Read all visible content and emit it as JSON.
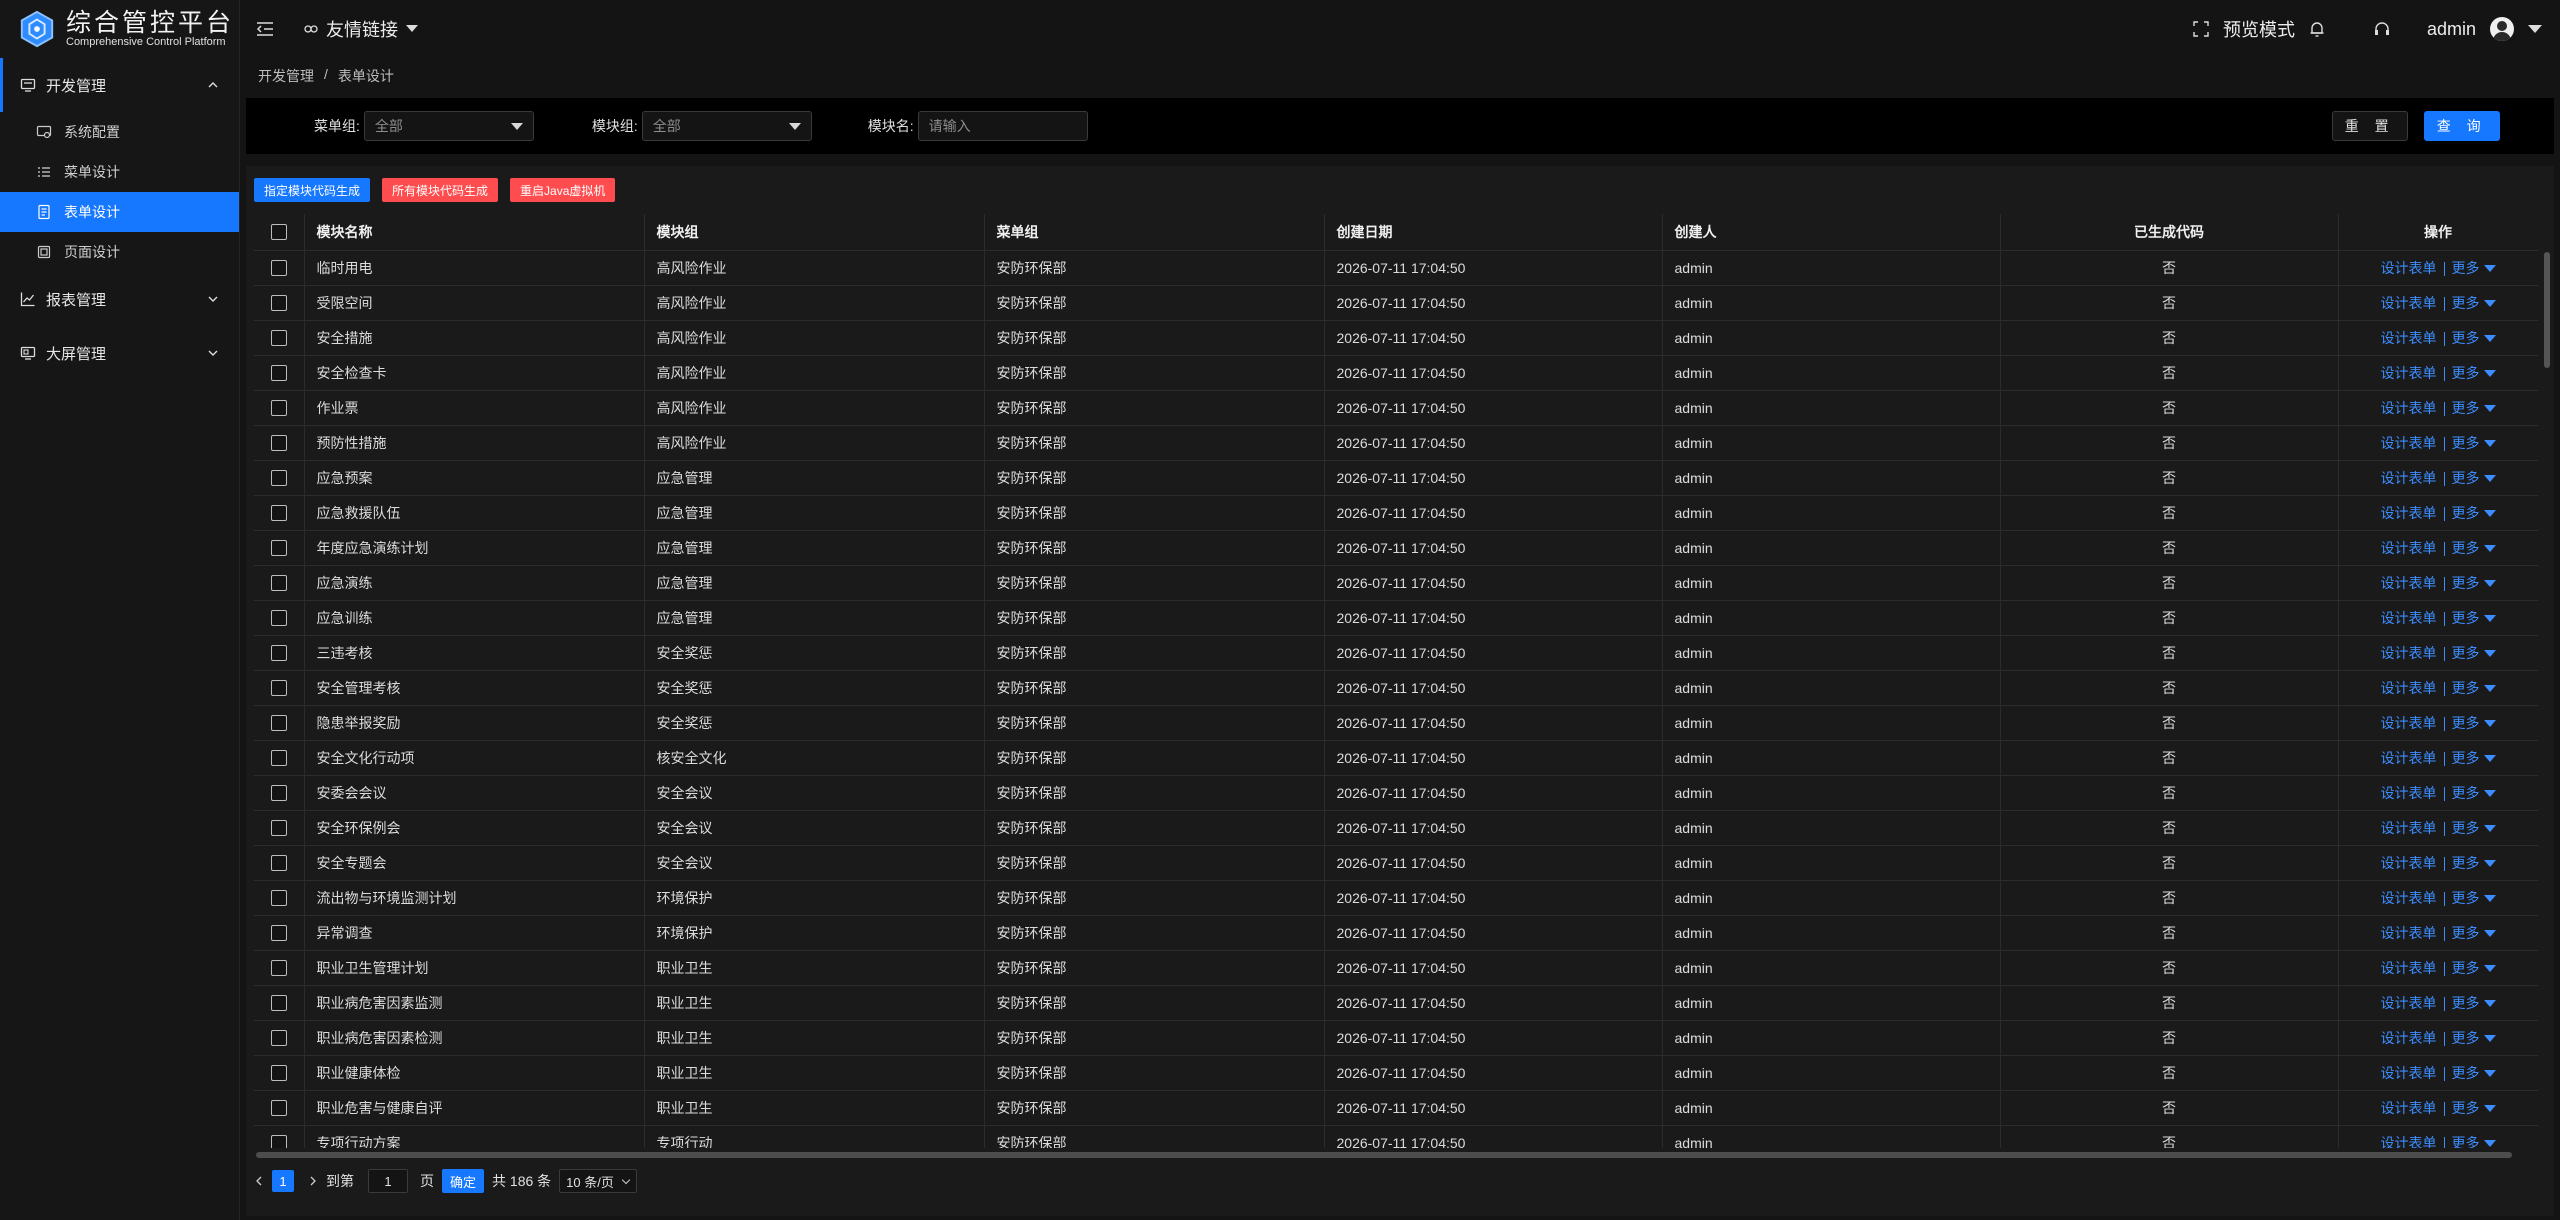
{
  "logo": {
    "title": "综合管控平台",
    "subtitle": "Comprehensive Control Platform",
    "icon": "hexagon-logo-icon"
  },
  "header": {
    "friend_link": "友情链接",
    "preview_mode": "预览模式",
    "user": "admin"
  },
  "sidebar": {
    "groups": [
      {
        "label": "开发管理",
        "icon": "monitor-icon",
        "expanded": true,
        "items": [
          {
            "label": "系统配置",
            "icon": "settings-monitor-icon"
          },
          {
            "label": "菜单设计",
            "icon": "list-icon"
          },
          {
            "label": "表单设计",
            "icon": "document-icon",
            "active": true
          },
          {
            "label": "页面设计",
            "icon": "page-icon"
          }
        ]
      },
      {
        "label": "报表管理",
        "icon": "line-chart-icon",
        "expanded": false
      },
      {
        "label": "大屏管理",
        "icon": "screen-icon",
        "expanded": false
      }
    ]
  },
  "breadcrumb": [
    "开发管理",
    "/",
    "表单设计"
  ],
  "filter": {
    "menu_group_label": "菜单组:",
    "menu_group_value": "全部",
    "module_group_label": "模块组:",
    "module_group_value": "全部",
    "module_name_label": "模块名:",
    "module_name_placeholder": "请输入",
    "reset": "重 置",
    "query": "查 询"
  },
  "actions": [
    "指定模块代码生成",
    "所有模块代码生成",
    "重启Java虚拟机"
  ],
  "table": {
    "columns": [
      "模块名称",
      "模块组",
      "菜单组",
      "创建日期",
      "创建人",
      "已生成代码",
      "操作"
    ],
    "op_design": "设计表单",
    "op_more": "更多",
    "rows": [
      [
        "临时用电",
        "高风险作业",
        "安防环保部",
        "2026-07-11 17:04:50",
        "admin",
        "否"
      ],
      [
        "受限空间",
        "高风险作业",
        "安防环保部",
        "2026-07-11 17:04:50",
        "admin",
        "否"
      ],
      [
        "安全措施",
        "高风险作业",
        "安防环保部",
        "2026-07-11 17:04:50",
        "admin",
        "否"
      ],
      [
        "安全检查卡",
        "高风险作业",
        "安防环保部",
        "2026-07-11 17:04:50",
        "admin",
        "否"
      ],
      [
        "作业票",
        "高风险作业",
        "安防环保部",
        "2026-07-11 17:04:50",
        "admin",
        "否"
      ],
      [
        "预防性措施",
        "高风险作业",
        "安防环保部",
        "2026-07-11 17:04:50",
        "admin",
        "否"
      ],
      [
        "应急预案",
        "应急管理",
        "安防环保部",
        "2026-07-11 17:04:50",
        "admin",
        "否"
      ],
      [
        "应急救援队伍",
        "应急管理",
        "安防环保部",
        "2026-07-11 17:04:50",
        "admin",
        "否"
      ],
      [
        "年度应急演练计划",
        "应急管理",
        "安防环保部",
        "2026-07-11 17:04:50",
        "admin",
        "否"
      ],
      [
        "应急演练",
        "应急管理",
        "安防环保部",
        "2026-07-11 17:04:50",
        "admin",
        "否"
      ],
      [
        "应急训练",
        "应急管理",
        "安防环保部",
        "2026-07-11 17:04:50",
        "admin",
        "否"
      ],
      [
        "三违考核",
        "安全奖惩",
        "安防环保部",
        "2026-07-11 17:04:50",
        "admin",
        "否"
      ],
      [
        "安全管理考核",
        "安全奖惩",
        "安防环保部",
        "2026-07-11 17:04:50",
        "admin",
        "否"
      ],
      [
        "隐患举报奖励",
        "安全奖惩",
        "安防环保部",
        "2026-07-11 17:04:50",
        "admin",
        "否"
      ],
      [
        "安全文化行动项",
        "核安全文化",
        "安防环保部",
        "2026-07-11 17:04:50",
        "admin",
        "否"
      ],
      [
        "安委会会议",
        "安全会议",
        "安防环保部",
        "2026-07-11 17:04:50",
        "admin",
        "否"
      ],
      [
        "安全环保例会",
        "安全会议",
        "安防环保部",
        "2026-07-11 17:04:50",
        "admin",
        "否"
      ],
      [
        "安全专题会",
        "安全会议",
        "安防环保部",
        "2026-07-11 17:04:50",
        "admin",
        "否"
      ],
      [
        "流出物与环境监测计划",
        "环境保护",
        "安防环保部",
        "2026-07-11 17:04:50",
        "admin",
        "否"
      ],
      [
        "异常调查",
        "环境保护",
        "安防环保部",
        "2026-07-11 17:04:50",
        "admin",
        "否"
      ],
      [
        "职业卫生管理计划",
        "职业卫生",
        "安防环保部",
        "2026-07-11 17:04:50",
        "admin",
        "否"
      ],
      [
        "职业病危害因素监测",
        "职业卫生",
        "安防环保部",
        "2026-07-11 17:04:50",
        "admin",
        "否"
      ],
      [
        "职业病危害因素检测",
        "职业卫生",
        "安防环保部",
        "2026-07-11 17:04:50",
        "admin",
        "否"
      ],
      [
        "职业健康体检",
        "职业卫生",
        "安防环保部",
        "2026-07-11 17:04:50",
        "admin",
        "否"
      ],
      [
        "职业危害与健康自评",
        "职业卫生",
        "安防环保部",
        "2026-07-11 17:04:50",
        "admin",
        "否"
      ],
      [
        "专项行动方案",
        "专项行动",
        "安防环保部",
        "2026-07-11 17:04:50",
        "admin",
        "否"
      ]
    ]
  },
  "pagination": {
    "current": "1",
    "goto_label": "到第",
    "goto_value": "1",
    "page_label": "页",
    "confirm": "确定",
    "total": "共 186 条",
    "page_size": "10 条/页"
  },
  "colors": {
    "accent": "#1677ff",
    "danger": "#ff4d4f",
    "link": "#3c8dff"
  }
}
